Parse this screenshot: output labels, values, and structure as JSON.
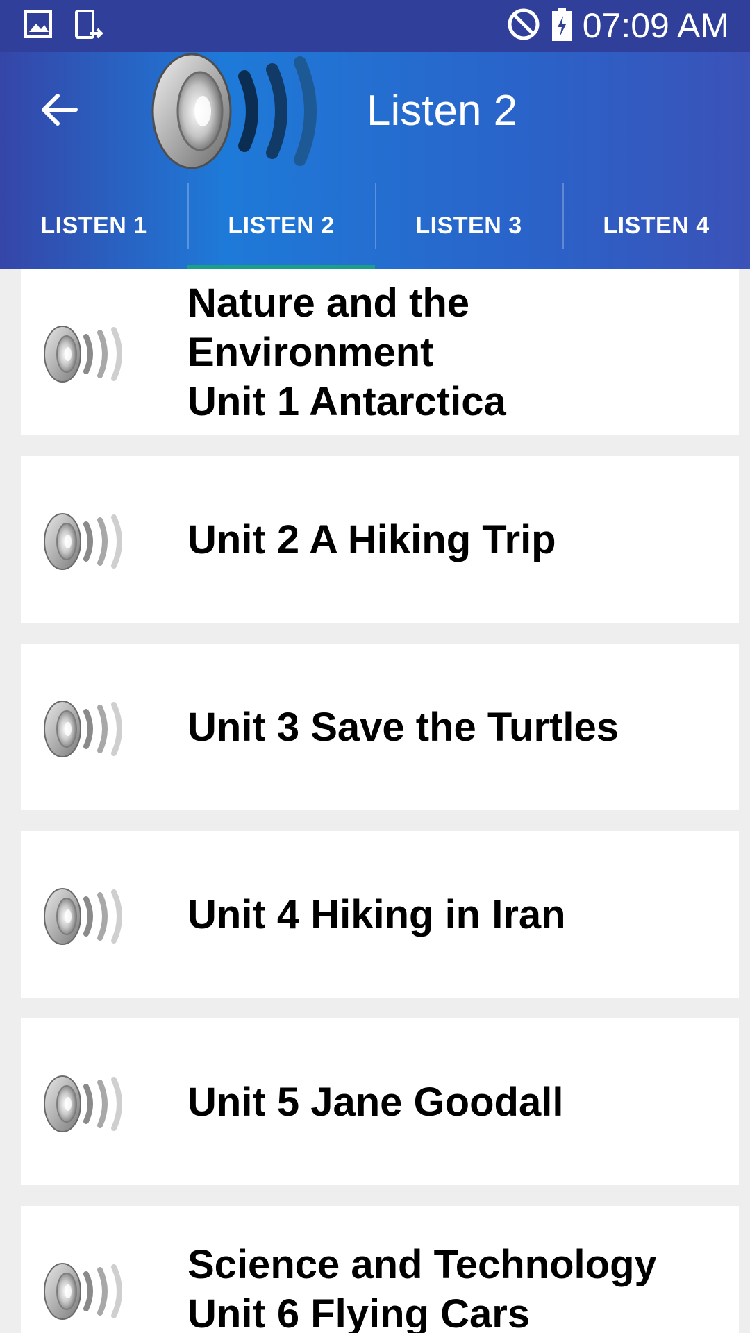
{
  "status_bar": {
    "time": "07:09 AM",
    "icons_left": [
      "image-icon",
      "device-sync-icon"
    ],
    "icons_right": [
      "do-not-disturb-icon",
      "battery-charging-icon"
    ]
  },
  "app_bar": {
    "title": "Listen 2",
    "back_icon": "arrow-left-icon",
    "header_icon": "speaker-icon"
  },
  "tabs": [
    {
      "label": "LISTEN 1",
      "active": false
    },
    {
      "label": "LISTEN 2",
      "active": true
    },
    {
      "label": "LISTEN 3",
      "active": false
    },
    {
      "label": "LISTEN 4",
      "active": false
    }
  ],
  "items": [
    {
      "lines": [
        "Nature and the",
        "Environment",
        "Unit 1 Antarctica"
      ],
      "icon": "speaker-icon"
    },
    {
      "lines": [
        "Unit 2 A Hiking Trip"
      ],
      "icon": "speaker-icon"
    },
    {
      "lines": [
        "Unit 3 Save the Turtles"
      ],
      "icon": "speaker-icon"
    },
    {
      "lines": [
        "Unit 4 Hiking in Iran"
      ],
      "icon": "speaker-icon"
    },
    {
      "lines": [
        "Unit 5 Jane Goodall"
      ],
      "icon": "speaker-icon"
    },
    {
      "lines": [
        "Science and Technology",
        "Unit 6 Flying Cars"
      ],
      "icon": "speaker-icon"
    }
  ],
  "colors": {
    "status_bar": "#2f3f9a",
    "app_bar_accent": "#1e7ad8",
    "tab_indicator": "#1a9f8a",
    "list_background": "#eeeeee",
    "card": "#ffffff"
  }
}
